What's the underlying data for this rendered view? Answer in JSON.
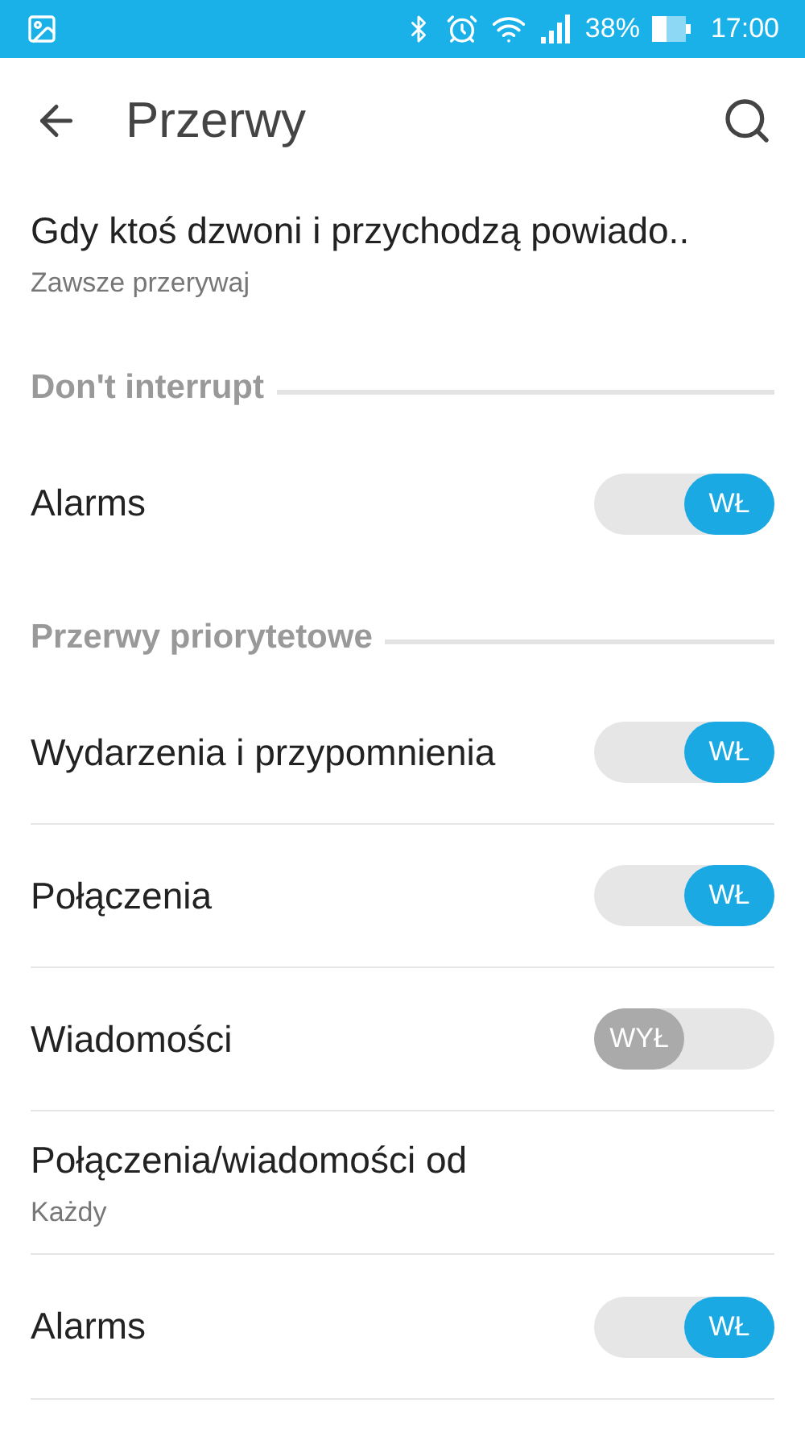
{
  "status_bar": {
    "battery": "38%",
    "time": "17:00"
  },
  "toolbar": {
    "title": "Przerwy"
  },
  "top_item": {
    "title": "Gdy ktoś dzwoni i przychodzą powiado..",
    "subtitle": "Zawsze przerywaj"
  },
  "sections": [
    {
      "header": "Don't interrupt",
      "items": [
        {
          "kind": "switch",
          "title": "Alarms",
          "on": true,
          "switch_text": "WŁ"
        }
      ]
    },
    {
      "header": "Przerwy priorytetowe",
      "items": [
        {
          "kind": "switch",
          "title": "Wydarzenia i przypomnienia",
          "on": true,
          "switch_text": "WŁ"
        },
        {
          "kind": "switch",
          "title": "Połączenia",
          "on": true,
          "switch_text": "WŁ"
        },
        {
          "kind": "switch",
          "title": "Wiadomości",
          "on": false,
          "switch_text": "WYŁ"
        },
        {
          "kind": "detail",
          "title": "Połączenia/wiadomości od",
          "subtitle": "Każdy"
        },
        {
          "kind": "switch",
          "title": "Alarms",
          "on": true,
          "switch_text": "WŁ"
        }
      ]
    }
  ]
}
